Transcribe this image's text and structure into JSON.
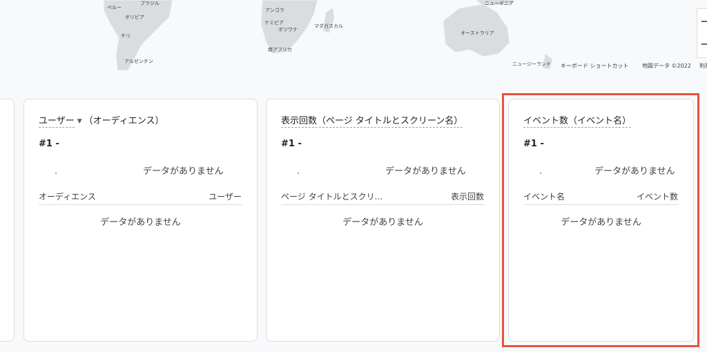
{
  "map": {
    "labels": {
      "peru": "ペルー",
      "brazil": "ブラジル",
      "bolivia": "ボリビア",
      "chile": "チリ",
      "argentina": "アルゼンチン",
      "angola": "アンゴラ",
      "namibia": "ナミビア",
      "botswana": "ボツワナ",
      "madagascar": "マダガスカル",
      "south_africa": "南アフリカ",
      "new_guinea": "ニューギニア",
      "australia": "オーストラリア",
      "new_zealand": "ニュージーランド"
    },
    "footer": {
      "shortcuts": "キーボード ショートカット",
      "map_data": "地図データ ©2022",
      "terms": "利用"
    },
    "zoom_in_icon": "plus-icon",
    "zoom_out_icon": "minus-icon"
  },
  "cards": [
    {
      "title_main": "ユーザー",
      "title_suffix": "（オーディエンス）",
      "rank": "#1  -",
      "no_data_top": "データがありません",
      "col_left": "オーディエンス",
      "col_right": "ユーザー",
      "no_data_body": "データがありません"
    },
    {
      "title_main": "表示回数（ページ タイトルとスクリーン名）",
      "rank": "#1  -",
      "no_data_top": "データがありません",
      "col_left": "ページ タイトルとスクリ...",
      "col_right": "表示回数",
      "no_data_body": "データがありません"
    },
    {
      "title_main": "イベント数（イベント名）",
      "rank": "#1  -",
      "no_data_top": "データがありません",
      "col_left": "イベント名",
      "col_right": "イベント数",
      "no_data_body": "データがありません"
    }
  ],
  "highlight_color": "#e5533d"
}
